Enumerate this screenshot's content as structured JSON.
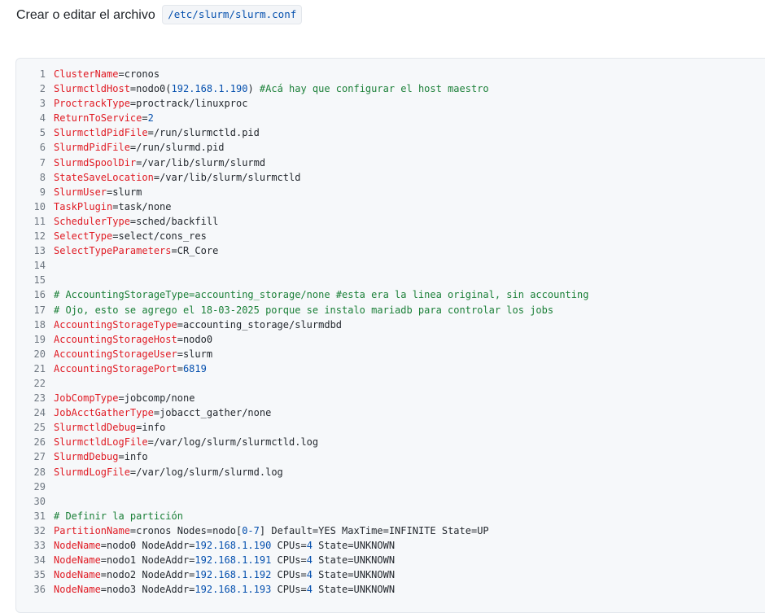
{
  "instruction": {
    "text": "Crear o editar el archivo",
    "path": "/etc/slurm/slurm.conf"
  },
  "colors": {
    "key": "#e01b24",
    "number": "#0550ae",
    "comment": "#1a7f37",
    "text": "#24292f",
    "line_number": "#6e7781",
    "code_background": "#f6f8fa"
  },
  "code_lines": [
    {
      "n": "1",
      "tokens": [
        {
          "t": "key",
          "v": "ClusterName"
        },
        {
          "t": "op",
          "v": "="
        },
        {
          "t": "val",
          "v": "cronos"
        }
      ]
    },
    {
      "n": "2",
      "tokens": [
        {
          "t": "key",
          "v": "SlurmctldHost"
        },
        {
          "t": "op",
          "v": "="
        },
        {
          "t": "val",
          "v": "nodo0("
        },
        {
          "t": "num",
          "v": "192.168.1.190"
        },
        {
          "t": "val",
          "v": ") "
        },
        {
          "t": "com",
          "v": "#Acá hay que configurar el host maestro"
        }
      ]
    },
    {
      "n": "3",
      "tokens": [
        {
          "t": "key",
          "v": "ProctrackType"
        },
        {
          "t": "op",
          "v": "="
        },
        {
          "t": "val",
          "v": "proctrack/linuxproc"
        }
      ]
    },
    {
      "n": "4",
      "tokens": [
        {
          "t": "key",
          "v": "ReturnToService"
        },
        {
          "t": "op",
          "v": "="
        },
        {
          "t": "num",
          "v": "2"
        }
      ]
    },
    {
      "n": "5",
      "tokens": [
        {
          "t": "key",
          "v": "SlurmctldPidFile"
        },
        {
          "t": "op",
          "v": "="
        },
        {
          "t": "val",
          "v": "/run/slurmctld.pid"
        }
      ]
    },
    {
      "n": "6",
      "tokens": [
        {
          "t": "key",
          "v": "SlurmdPidFile"
        },
        {
          "t": "op",
          "v": "="
        },
        {
          "t": "val",
          "v": "/run/slurmd.pid"
        }
      ]
    },
    {
      "n": "7",
      "tokens": [
        {
          "t": "key",
          "v": "SlurmdSpoolDir"
        },
        {
          "t": "op",
          "v": "="
        },
        {
          "t": "val",
          "v": "/var/lib/slurm/slurmd"
        }
      ]
    },
    {
      "n": "8",
      "tokens": [
        {
          "t": "key",
          "v": "StateSaveLocation"
        },
        {
          "t": "op",
          "v": "="
        },
        {
          "t": "val",
          "v": "/var/lib/slurm/slurmctld"
        }
      ]
    },
    {
      "n": "9",
      "tokens": [
        {
          "t": "key",
          "v": "SlurmUser"
        },
        {
          "t": "op",
          "v": "="
        },
        {
          "t": "val",
          "v": "slurm"
        }
      ]
    },
    {
      "n": "10",
      "tokens": [
        {
          "t": "key",
          "v": "TaskPlugin"
        },
        {
          "t": "op",
          "v": "="
        },
        {
          "t": "val",
          "v": "task/none"
        }
      ]
    },
    {
      "n": "11",
      "tokens": [
        {
          "t": "key",
          "v": "SchedulerType"
        },
        {
          "t": "op",
          "v": "="
        },
        {
          "t": "val",
          "v": "sched/backfill"
        }
      ]
    },
    {
      "n": "12",
      "tokens": [
        {
          "t": "key",
          "v": "SelectType"
        },
        {
          "t": "op",
          "v": "="
        },
        {
          "t": "val",
          "v": "select/cons_res"
        }
      ]
    },
    {
      "n": "13",
      "tokens": [
        {
          "t": "key",
          "v": "SelectTypeParameters"
        },
        {
          "t": "op",
          "v": "="
        },
        {
          "t": "val",
          "v": "CR_Core"
        }
      ]
    },
    {
      "n": "14",
      "tokens": []
    },
    {
      "n": "15",
      "tokens": []
    },
    {
      "n": "16",
      "tokens": [
        {
          "t": "com",
          "v": "# AccountingStorageType=accounting_storage/none #esta era la linea original, sin accounting"
        }
      ]
    },
    {
      "n": "17",
      "tokens": [
        {
          "t": "com",
          "v": "# Ojo, esto se agrego el 18-03-2025 porque se instalo mariadb para controlar los jobs"
        }
      ]
    },
    {
      "n": "18",
      "tokens": [
        {
          "t": "key",
          "v": "AccountingStorageType"
        },
        {
          "t": "op",
          "v": "="
        },
        {
          "t": "val",
          "v": "accounting_storage/slurmdbd"
        }
      ]
    },
    {
      "n": "19",
      "tokens": [
        {
          "t": "key",
          "v": "AccountingStorageHost"
        },
        {
          "t": "op",
          "v": "="
        },
        {
          "t": "val",
          "v": "nodo0"
        }
      ]
    },
    {
      "n": "20",
      "tokens": [
        {
          "t": "key",
          "v": "AccountingStorageUser"
        },
        {
          "t": "op",
          "v": "="
        },
        {
          "t": "val",
          "v": "slurm"
        }
      ]
    },
    {
      "n": "21",
      "tokens": [
        {
          "t": "key",
          "v": "AccountingStoragePort"
        },
        {
          "t": "op",
          "v": "="
        },
        {
          "t": "num",
          "v": "6819"
        }
      ]
    },
    {
      "n": "22",
      "tokens": []
    },
    {
      "n": "23",
      "tokens": [
        {
          "t": "key",
          "v": "JobCompType"
        },
        {
          "t": "op",
          "v": "="
        },
        {
          "t": "val",
          "v": "jobcomp/none"
        }
      ]
    },
    {
      "n": "24",
      "tokens": [
        {
          "t": "key",
          "v": "JobAcctGatherType"
        },
        {
          "t": "op",
          "v": "="
        },
        {
          "t": "val",
          "v": "jobacct_gather/none"
        }
      ]
    },
    {
      "n": "25",
      "tokens": [
        {
          "t": "key",
          "v": "SlurmctldDebug"
        },
        {
          "t": "op",
          "v": "="
        },
        {
          "t": "val",
          "v": "info"
        }
      ]
    },
    {
      "n": "26",
      "tokens": [
        {
          "t": "key",
          "v": "SlurmctldLogFile"
        },
        {
          "t": "op",
          "v": "="
        },
        {
          "t": "val",
          "v": "/var/log/slurm/slurmctld.log"
        }
      ]
    },
    {
      "n": "27",
      "tokens": [
        {
          "t": "key",
          "v": "SlurmdDebug"
        },
        {
          "t": "op",
          "v": "="
        },
        {
          "t": "val",
          "v": "info"
        }
      ]
    },
    {
      "n": "28",
      "tokens": [
        {
          "t": "key",
          "v": "SlurmdLogFile"
        },
        {
          "t": "op",
          "v": "="
        },
        {
          "t": "val",
          "v": "/var/log/slurm/slurmd.log"
        }
      ]
    },
    {
      "n": "29",
      "tokens": []
    },
    {
      "n": "30",
      "tokens": []
    },
    {
      "n": "31",
      "tokens": [
        {
          "t": "com",
          "v": "# Definir la partición"
        }
      ]
    },
    {
      "n": "32",
      "tokens": [
        {
          "t": "key",
          "v": "PartitionName"
        },
        {
          "t": "op",
          "v": "="
        },
        {
          "t": "val",
          "v": "cronos Nodes=nodo["
        },
        {
          "t": "num",
          "v": "0-7"
        },
        {
          "t": "val",
          "v": "] Default=YES MaxTime=INFINITE State=UP"
        }
      ]
    },
    {
      "n": "33",
      "tokens": [
        {
          "t": "key",
          "v": "NodeName"
        },
        {
          "t": "op",
          "v": "="
        },
        {
          "t": "val",
          "v": "nodo0 NodeAddr="
        },
        {
          "t": "num",
          "v": "192.168.1.190"
        },
        {
          "t": "val",
          "v": " CPUs="
        },
        {
          "t": "num",
          "v": "4"
        },
        {
          "t": "val",
          "v": " State=UNKNOWN"
        }
      ]
    },
    {
      "n": "34",
      "tokens": [
        {
          "t": "key",
          "v": "NodeName"
        },
        {
          "t": "op",
          "v": "="
        },
        {
          "t": "val",
          "v": "nodo1 NodeAddr="
        },
        {
          "t": "num",
          "v": "192.168.1.191"
        },
        {
          "t": "val",
          "v": " CPUs="
        },
        {
          "t": "num",
          "v": "4"
        },
        {
          "t": "val",
          "v": " State=UNKNOWN"
        }
      ]
    },
    {
      "n": "35",
      "tokens": [
        {
          "t": "key",
          "v": "NodeName"
        },
        {
          "t": "op",
          "v": "="
        },
        {
          "t": "val",
          "v": "nodo2 NodeAddr="
        },
        {
          "t": "num",
          "v": "192.168.1.192"
        },
        {
          "t": "val",
          "v": " CPUs="
        },
        {
          "t": "num",
          "v": "4"
        },
        {
          "t": "val",
          "v": " State=UNKNOWN"
        }
      ]
    },
    {
      "n": "36",
      "tokens": [
        {
          "t": "key",
          "v": "NodeName"
        },
        {
          "t": "op",
          "v": "="
        },
        {
          "t": "val",
          "v": "nodo3 NodeAddr="
        },
        {
          "t": "num",
          "v": "192.168.1.193"
        },
        {
          "t": "val",
          "v": " CPUs="
        },
        {
          "t": "num",
          "v": "4"
        },
        {
          "t": "val",
          "v": " State=UNKNOWN"
        }
      ]
    }
  ]
}
